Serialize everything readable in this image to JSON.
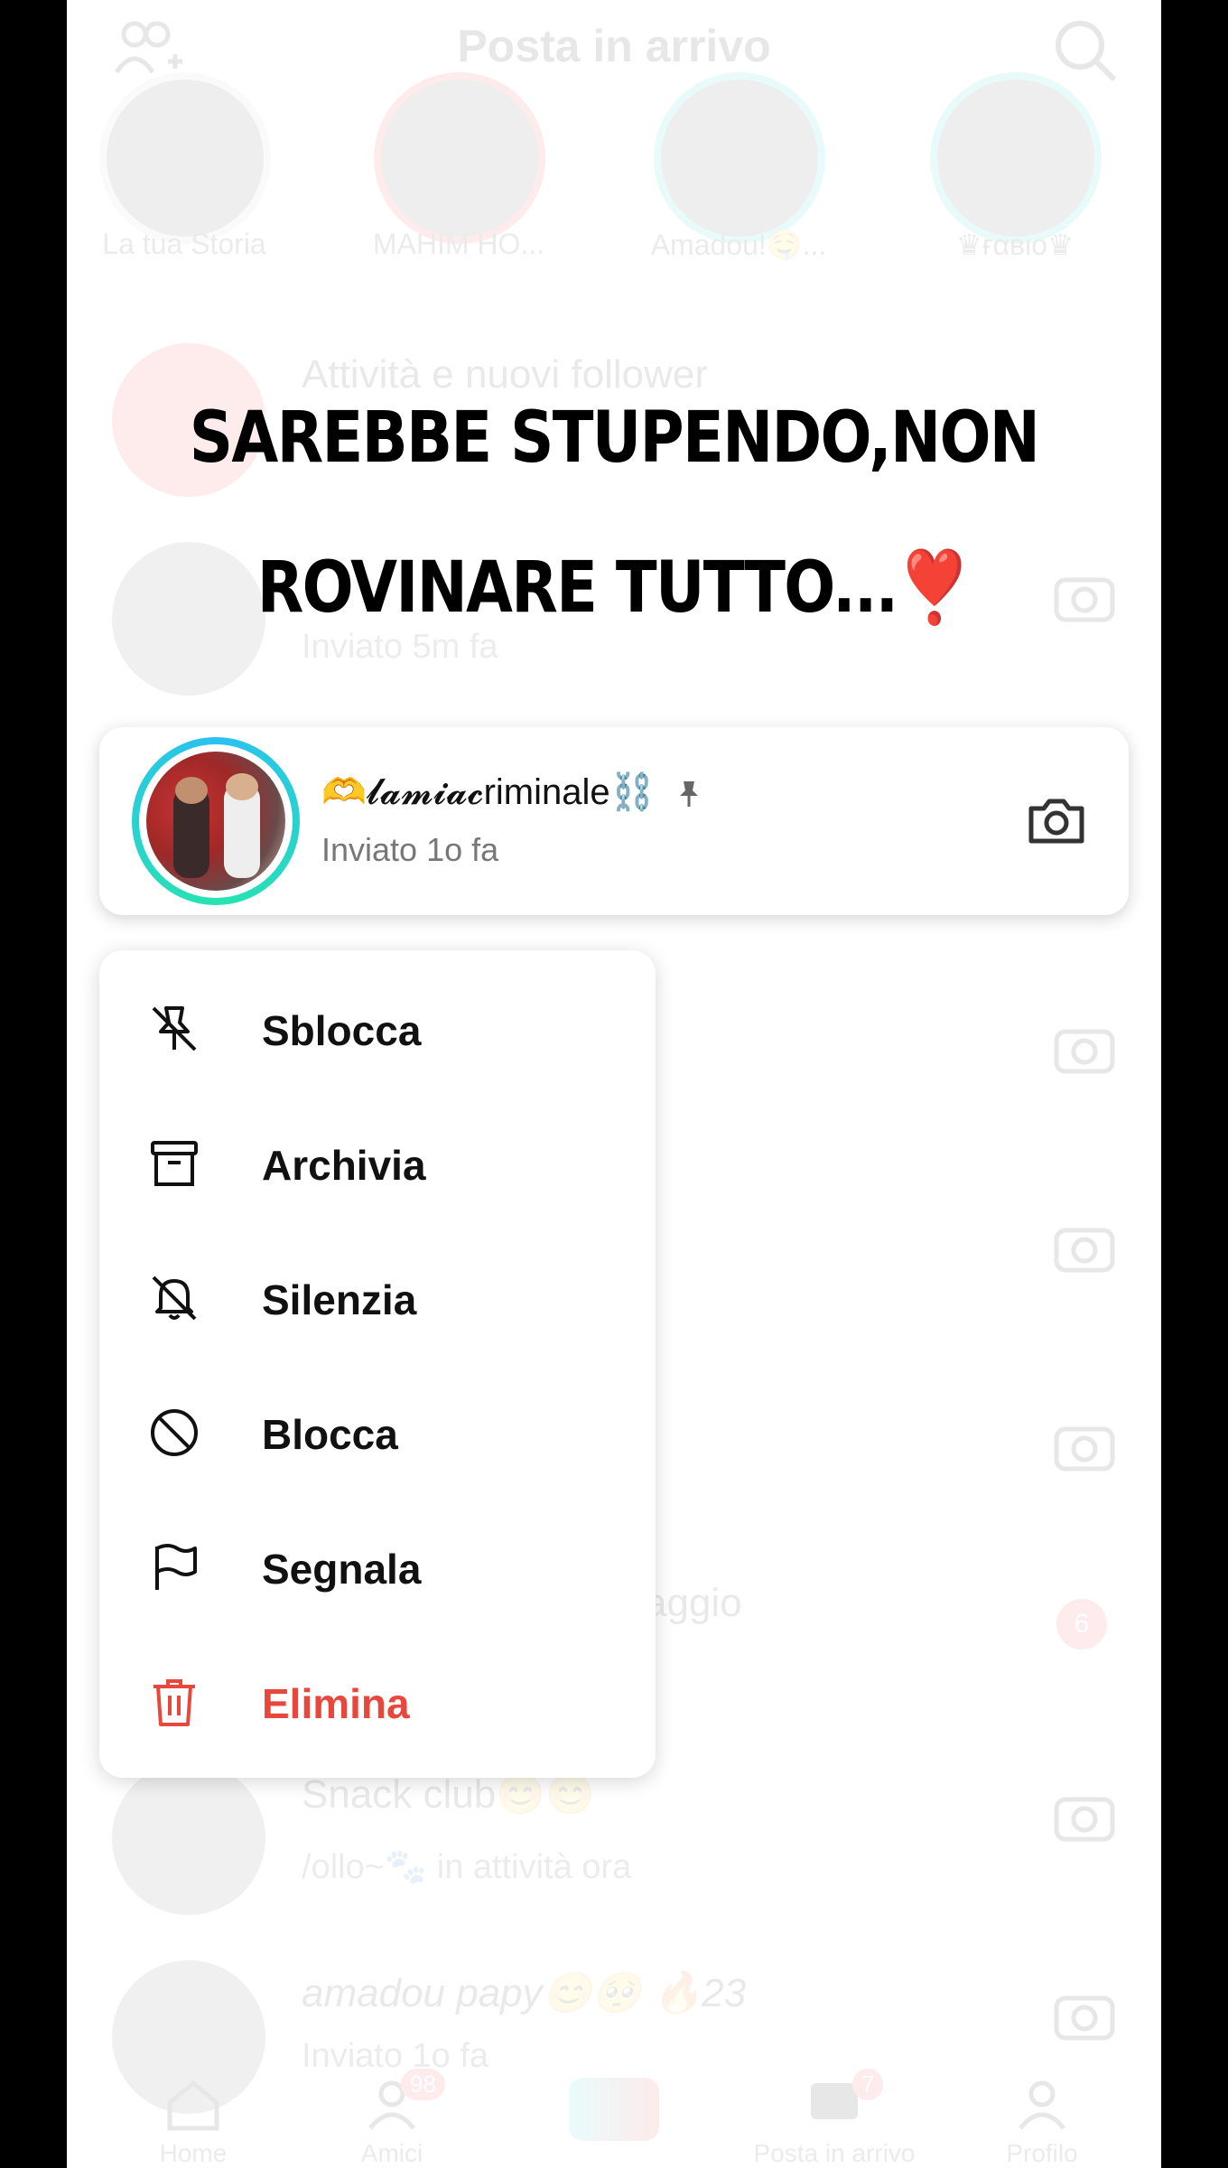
{
  "header": {
    "title": "Posta in arrivo"
  },
  "stories": [
    {
      "name": "La tua Storia"
    },
    {
      "name": "MAHIM HO..."
    },
    {
      "name": "Amadou!🤤..."
    },
    {
      "name": "♛ғαвιо♛"
    }
  ],
  "background_rows": [
    {
      "title": "Attività e nuovi follower",
      "subtitle": ""
    },
    {
      "title": "",
      "subtitle": "Inviato 5m fa"
    },
    {
      "title": "",
      "subtitle": ""
    },
    {
      "title": "",
      "subtitle": ""
    },
    {
      "title": "",
      "subtitle": ""
    },
    {
      "title": "aggio",
      "subtitle": "",
      "badge": "6"
    },
    {
      "title": "Snack club😊😊",
      "subtitle": "/ollo~🐾 in attività ora"
    },
    {
      "title": "amadou papy😊🥺 🔥23",
      "subtitle": "Inviato 1o fa"
    }
  ],
  "overlay_caption": {
    "line1": "SAREBBE STUPENDO,NON",
    "line2": "ROVINARE TUTTO...❣️"
  },
  "pinned_chat": {
    "name": "🫶𝓵𝓪𝓶𝓲𝓪𝓬riminale⛓️",
    "subtitle": "Inviato 1o fa"
  },
  "context_menu": {
    "items": [
      {
        "label": "Sblocca",
        "icon": "unpin-icon"
      },
      {
        "label": "Archivia",
        "icon": "archive-icon"
      },
      {
        "label": "Silenzia",
        "icon": "bell-off-icon"
      },
      {
        "label": "Blocca",
        "icon": "block-icon"
      },
      {
        "label": "Segnala",
        "icon": "flag-icon"
      },
      {
        "label": "Elimina",
        "icon": "trash-icon",
        "color": "#e8473c"
      }
    ]
  },
  "tabbar": {
    "tabs": [
      {
        "label": "Home"
      },
      {
        "label": "Amici",
        "badge": "98"
      },
      {
        "label": ""
      },
      {
        "label": "Posta in arrivo",
        "badge": "7"
      },
      {
        "label": "Profilo"
      }
    ]
  },
  "colors": {
    "danger": "#e8473c",
    "ring_start": "#2ac1f0",
    "ring_end": "#27e3b0"
  }
}
